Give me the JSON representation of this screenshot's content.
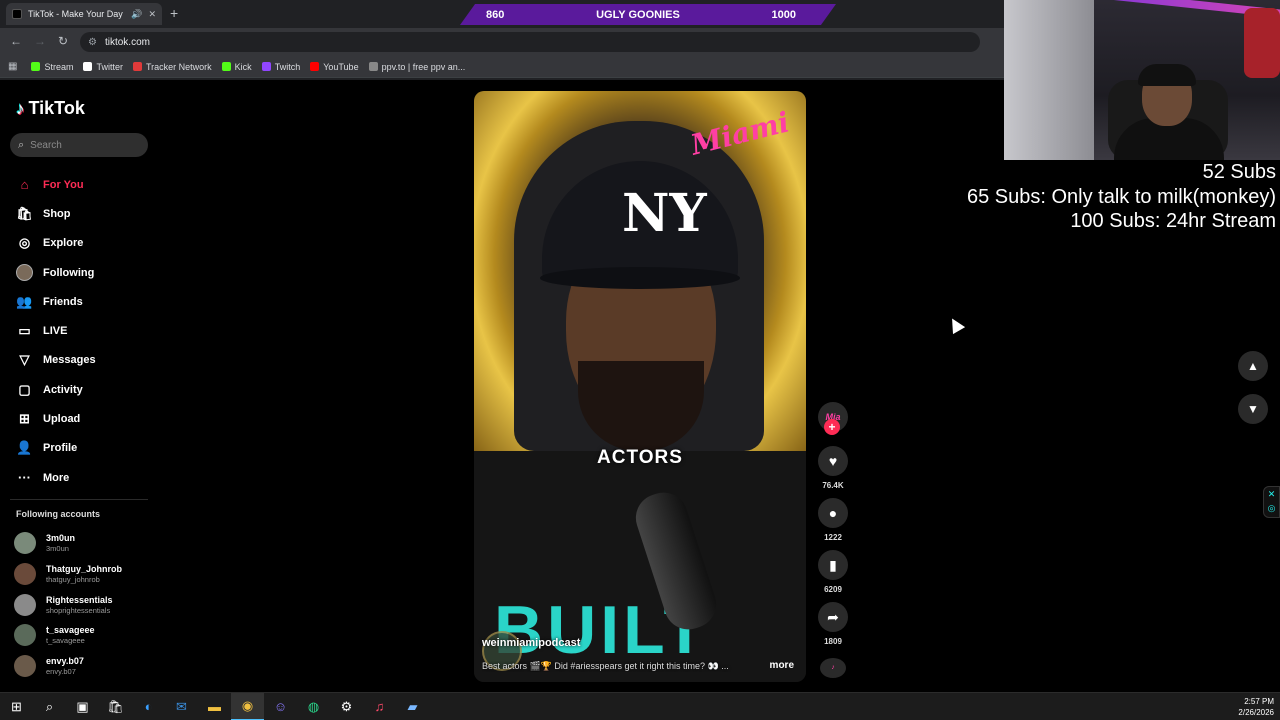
{
  "browser": {
    "tab_title": "TikTok - Make Your Day",
    "url": "tiktok.com",
    "bookmarks": [
      {
        "label": "Stream",
        "color": "#53fc18"
      },
      {
        "label": "Twitter",
        "color": "#ffffff"
      },
      {
        "label": "Tracker Network",
        "color": "#e03a3a"
      },
      {
        "label": "Kick",
        "color": "#53fc18"
      },
      {
        "label": "Twitch",
        "color": "#9146ff"
      },
      {
        "label": "YouTube",
        "color": "#ff0000"
      },
      {
        "label": "ppv.to | free ppv an...",
        "color": "#888888"
      }
    ]
  },
  "overlay": {
    "goal_left": "860",
    "goal_name": "UGLY GOONIES",
    "goal_right": "1000",
    "subs_lines": [
      "52 Subs",
      "65 Subs: Only talk to milk(monkey)",
      "100 Subs: 24hr Stream"
    ]
  },
  "tiktok": {
    "logo": "TikTok",
    "search_placeholder": "Search",
    "menu": [
      {
        "label": "For You",
        "icon": "home-icon",
        "glyph": "⌂",
        "active": true
      },
      {
        "label": "Shop",
        "icon": "shop-icon",
        "glyph": "🛍"
      },
      {
        "label": "Explore",
        "icon": "compass-icon",
        "glyph": "◎"
      },
      {
        "label": "Following",
        "icon": "avatar",
        "glyph": ""
      },
      {
        "label": "Friends",
        "icon": "friends-icon",
        "glyph": "👥"
      },
      {
        "label": "LIVE",
        "icon": "live-icon",
        "glyph": "▭"
      },
      {
        "label": "Messages",
        "icon": "send-icon",
        "glyph": "▽"
      },
      {
        "label": "Activity",
        "icon": "activity-icon",
        "glyph": "▢"
      },
      {
        "label": "Upload",
        "icon": "upload-icon",
        "glyph": "⊞"
      },
      {
        "label": "Profile",
        "icon": "profile-icon",
        "glyph": "👤"
      },
      {
        "label": "More",
        "icon": "more-icon",
        "glyph": "···"
      }
    ],
    "following_title": "Following accounts",
    "accounts": [
      {
        "name": "3m0un",
        "handle": "3m0un",
        "color": "#7a8a7a"
      },
      {
        "name": "Thatguy_Johnrob",
        "handle": "thatguy_johnrob",
        "color": "#6a4a3a"
      },
      {
        "name": "Rightessentials",
        "handle": "shoprightessentials",
        "color": "#8a8a8a"
      },
      {
        "name": "t_savageee",
        "handle": "t_savageee",
        "color": "#5a6a5a"
      },
      {
        "name": "envy.b07",
        "handle": "envy.b07",
        "color": "#6a5a4a"
      }
    ]
  },
  "video": {
    "caption": "ACTORS",
    "handle": "weinmiamipodcast",
    "description": "Best actors 🎬🏆 Did #ariesspears get it right this time? 👀 ...",
    "more_label": "more",
    "brand_text": "Miami",
    "cap_logo": "NY",
    "shirt_text": "BUILT",
    "likes": "76.4K",
    "comments": "1222",
    "saves": "6209",
    "shares": "1809"
  },
  "taskbar": {
    "time": "2:57 PM",
    "date": "2/26/2026"
  }
}
